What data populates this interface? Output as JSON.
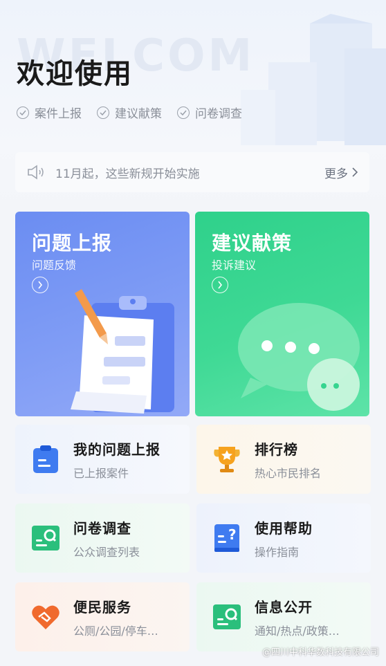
{
  "header": {
    "watermark": "WELCOM",
    "title": "欢迎使用",
    "tags": [
      "案件上报",
      "建议献策",
      "问卷调查"
    ]
  },
  "notice": {
    "text": "11月起，这些新规开始实施",
    "more_label": "更多"
  },
  "feature_cards": [
    {
      "title": "问题上报",
      "subtitle": "问题反馈",
      "color": "#7393f3"
    },
    {
      "title": "建议献策",
      "subtitle": "投诉建议",
      "color": "#36d48f"
    }
  ],
  "service_grid": [
    {
      "title": "我的问题上报",
      "subtitle": "已上报案件",
      "icon": "clipboard-icon"
    },
    {
      "title": "排行榜",
      "subtitle": "热心市民排名",
      "icon": "trophy-icon"
    },
    {
      "title": "问卷调查",
      "subtitle": "公众调查列表",
      "icon": "survey-icon"
    },
    {
      "title": "使用帮助",
      "subtitle": "操作指南",
      "icon": "help-book-icon"
    },
    {
      "title": "便民服务",
      "subtitle": "公厕/公园/停车…",
      "icon": "heart-handshake-icon"
    },
    {
      "title": "信息公开",
      "subtitle": "通知/热点/政策…",
      "icon": "info-public-icon"
    }
  ],
  "footer": {
    "credit": "@四川中科华数科技有限公司"
  }
}
